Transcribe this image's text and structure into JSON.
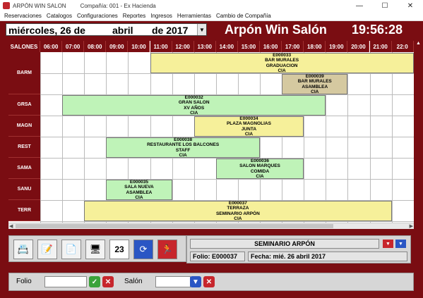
{
  "window": {
    "app_name": "ARPÓN WIN SALON",
    "company": "Compañía: 001 - Ex Hacienda"
  },
  "menu": [
    "Reservaciones",
    "Catalogos",
    "Configuraciones",
    "Reportes",
    "Ingresos",
    "Herramientas",
    "Cambio de Compañía"
  ],
  "date": {
    "weekday_day": "miércoles, 26 de",
    "month": "abril",
    "year_prefix": "de 2017"
  },
  "app_title": "Arpón Win Salón",
  "clock": "19:56:28",
  "grid": {
    "corner_label": "SALONES",
    "hours": [
      "06:00",
      "07:00",
      "08:00",
      "09:00",
      "10:00",
      "11:00",
      "12:00",
      "13:00",
      "14:00",
      "15:00",
      "16:00",
      "17:00",
      "18:00",
      "19:00",
      "20:00",
      "21:00",
      "22:0"
    ],
    "rooms": [
      {
        "code": "BARM",
        "rows": 2
      },
      {
        "code": "GRSA",
        "rows": 1
      },
      {
        "code": "MAGN",
        "rows": 1
      },
      {
        "code": "REST",
        "rows": 1
      },
      {
        "code": "SAMA",
        "rows": 1
      },
      {
        "code": "SANU",
        "rows": 1
      },
      {
        "code": "TERR",
        "rows": 1
      }
    ],
    "reservations": [
      {
        "folio": "E000033",
        "l1": "BAR MURALES",
        "l2": "GRADUACION",
        "l3": "CIA",
        "color": "#f6f09a",
        "start": 5,
        "end": 17,
        "row": 0
      },
      {
        "folio": "E000039",
        "l1": "BAR MURALES",
        "l2": "ASAMBLEA",
        "l3": "CIA",
        "color": "#d5c9a0",
        "start": 11,
        "end": 14,
        "row": 1
      },
      {
        "folio": "E000032",
        "l1": "GRAN SALON",
        "l2": "XV AÑOS",
        "l3": "CIA",
        "color": "#bff3b8",
        "start": 1,
        "end": 13,
        "row": 2
      },
      {
        "folio": "E000034",
        "l1": "PLAZA MAGNOLIAS",
        "l2": "JUNTA",
        "l3": "CIA",
        "color": "#f6f09a",
        "start": 7,
        "end": 12,
        "row": 3
      },
      {
        "folio": "E000038",
        "l1": "RESTAURANTE LOS BALCONES",
        "l2": "STAFF",
        "l3": "CIA",
        "color": "#bff3b8",
        "start": 3,
        "end": 10,
        "row": 4
      },
      {
        "folio": "E000036",
        "l1": "SALON MARQUES",
        "l2": "COMIDA",
        "l3": "CIA",
        "color": "#bff3b8",
        "start": 8,
        "end": 12,
        "row": 5
      },
      {
        "folio": "E000035",
        "l1": "SALA NUEVA",
        "l2": "ASAMBLEA",
        "l3": "CIA",
        "color": "#bff3b8",
        "start": 3,
        "end": 6,
        "row": 6
      },
      {
        "folio": "E000037",
        "l1": "TERRAZA",
        "l2": "SEMINARIO ARPÓN",
        "l3": "CIA",
        "color": "#f6f09a",
        "start": 2,
        "end": 16,
        "row": 7
      }
    ]
  },
  "toolbar": {
    "buttons": [
      {
        "name": "new-reservation-icon",
        "glyph": "📇"
      },
      {
        "name": "edit-reservation-icon",
        "glyph": "📝"
      },
      {
        "name": "document-icon",
        "glyph": "📄"
      },
      {
        "name": "rooms-icon",
        "glyph": "🖥"
      },
      {
        "name": "calendar-icon",
        "glyph": "23"
      },
      {
        "name": "refresh-icon",
        "glyph": "⟳"
      },
      {
        "name": "exit-icon",
        "glyph": "🏃"
      }
    ]
  },
  "info": {
    "title": "SEMINARIO ARPÓN",
    "folio": "Folio: E000037",
    "fecha": "Fecha: mié. 26 abril 2017"
  },
  "bottom": {
    "folio_label": "Folio",
    "salon_label": "Salón"
  }
}
